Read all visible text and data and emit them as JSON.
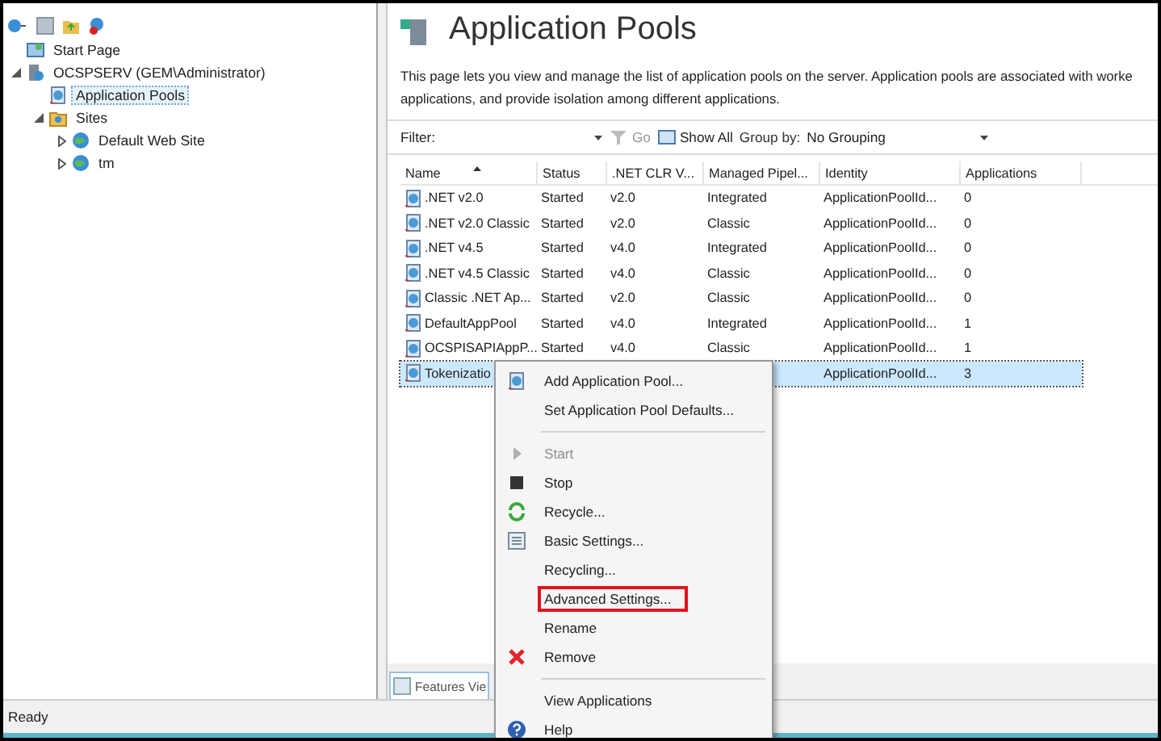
{
  "tree": [
    {
      "label": "Start Page",
      "selected": false
    },
    {
      "label": "OCSPSERV (GEM\\Administrator)",
      "expanded": true,
      "selected": false,
      "children": [
        {
          "label": "Application Pools",
          "selected": true
        },
        {
          "label": "Sites",
          "expanded": true,
          "selected": false,
          "children": [
            {
              "label": "Default Web Site",
              "expanded": false,
              "selected": false
            },
            {
              "label": "tm",
              "expanded": false,
              "selected": false
            }
          ]
        }
      ]
    }
  ],
  "page": {
    "title": "Application Pools",
    "description_lines": [
      "This page lets you view and manage the list of application pools on the server. Application pools are associated with worke",
      "applications, and provide isolation among different applications."
    ]
  },
  "filter_bar": {
    "filter_label": "Filter:",
    "go": "Go",
    "show_all": "Show All",
    "group_by_label": "Group by:",
    "group_by_value": "No Grouping"
  },
  "table": {
    "columns": [
      {
        "label": "Name",
        "sorted": true
      },
      {
        "label": "Status",
        "sorted": false
      },
      {
        "label": ".NET CLR V...",
        "sorted": false
      },
      {
        "label": "Managed Pipel...",
        "sorted": false
      },
      {
        "label": "Identity",
        "sorted": false
      },
      {
        "label": "Applications",
        "sorted": false
      }
    ],
    "rows": [
      {
        "selected": false,
        "cells": [
          ".NET v2.0",
          "Started",
          "v2.0",
          "Integrated",
          "ApplicationPoolId...",
          "0"
        ]
      },
      {
        "selected": false,
        "cells": [
          ".NET v2.0 Classic",
          "Started",
          "v2.0",
          "Classic",
          "ApplicationPoolId...",
          "0"
        ]
      },
      {
        "selected": false,
        "cells": [
          ".NET v4.5",
          "Started",
          "v4.0",
          "Integrated",
          "ApplicationPoolId...",
          "0"
        ]
      },
      {
        "selected": false,
        "cells": [
          ".NET v4.5 Classic",
          "Started",
          "v4.0",
          "Classic",
          "ApplicationPoolId...",
          "0"
        ]
      },
      {
        "selected": false,
        "cells": [
          "Classic .NET Ap...",
          "Started",
          "v2.0",
          "Classic",
          "ApplicationPoolId...",
          "0"
        ]
      },
      {
        "selected": false,
        "cells": [
          "DefaultAppPool",
          "Started",
          "v4.0",
          "Integrated",
          "ApplicationPoolId...",
          "1"
        ]
      },
      {
        "selected": false,
        "cells": [
          "OCSPISAPIAppP...",
          "Started",
          "v4.0",
          "Classic",
          "ApplicationPoolId...",
          "1"
        ]
      },
      {
        "selected": true,
        "cells": [
          "Tokenizatio",
          "",
          "",
          "",
          "ApplicationPoolId...",
          "3"
        ]
      }
    ]
  },
  "view_tab": {
    "label": "Features Vie"
  },
  "status_bar": {
    "text": "Ready"
  },
  "context_menu": [
    {
      "kind": "item",
      "label": "Add Application Pool...",
      "disabled": false,
      "highlighted": false
    },
    {
      "kind": "item",
      "label": "Set Application Pool Defaults...",
      "disabled": false,
      "highlighted": false
    },
    {
      "kind": "separator"
    },
    {
      "kind": "item",
      "label": "Start",
      "disabled": true,
      "highlighted": false
    },
    {
      "kind": "item",
      "label": "Stop",
      "disabled": false,
      "highlighted": false
    },
    {
      "kind": "item",
      "label": "Recycle...",
      "disabled": false,
      "highlighted": false
    },
    {
      "kind": "item",
      "label": "Basic Settings...",
      "disabled": false,
      "highlighted": false
    },
    {
      "kind": "item",
      "label": "Recycling...",
      "disabled": false,
      "highlighted": false
    },
    {
      "kind": "item",
      "label": "Advanced Settings...",
      "disabled": false,
      "highlighted": true
    },
    {
      "kind": "item",
      "label": "Rename",
      "disabled": false,
      "highlighted": false
    },
    {
      "kind": "item",
      "label": "Remove",
      "disabled": false,
      "highlighted": false
    },
    {
      "kind": "separator"
    },
    {
      "kind": "item",
      "label": "View Applications",
      "disabled": false,
      "highlighted": false
    },
    {
      "kind": "item",
      "label": "Help",
      "disabled": false,
      "highlighted": false
    }
  ]
}
